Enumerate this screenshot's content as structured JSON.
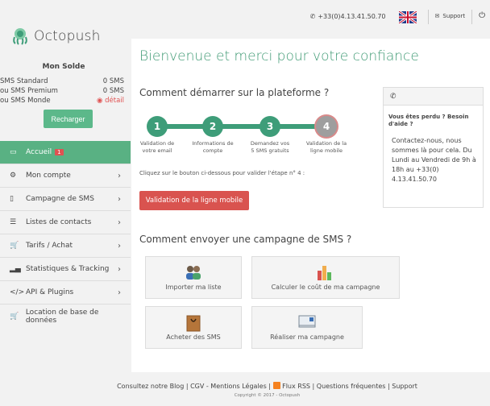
{
  "topbar": {
    "phone": "+33(0)4.13.41.50.70",
    "support_label": "Support"
  },
  "brand": {
    "name": "Octopush"
  },
  "balance": {
    "title": "Mon Solde",
    "rows": [
      {
        "label": "SMS Standard",
        "value": "0 SMS"
      },
      {
        "label": "ou SMS Premium",
        "value": "0 SMS"
      },
      {
        "label": "ou SMS Monde",
        "value": "détail"
      }
    ],
    "recharge_label": "Recharger"
  },
  "nav": {
    "items": [
      {
        "label": "Accueil",
        "badge": "1",
        "icon": "monitor-icon",
        "active": true
      },
      {
        "label": "Mon compte",
        "icon": "gear-icon"
      },
      {
        "label": "Campagne de SMS",
        "icon": "mobile-icon"
      },
      {
        "label": "Listes de contacts",
        "icon": "list-icon"
      },
      {
        "label": "Tarifs / Achat",
        "icon": "cart-icon"
      },
      {
        "label": "Statistiques & Tracking",
        "icon": "bar-chart-icon"
      },
      {
        "label": "API & Plugins",
        "icon": "code-icon"
      },
      {
        "label": "Location de base de données",
        "icon": "cart-icon"
      }
    ]
  },
  "main": {
    "welcome": "Bienvenue et merci pour votre confiance",
    "start_heading": "Comment démarrer sur la plateforme ?",
    "steps": [
      {
        "num": "1",
        "label": "Validation de votre email",
        "done": true
      },
      {
        "num": "2",
        "label": "Informations de compte",
        "done": true
      },
      {
        "num": "3",
        "label": "Demandez vos 5 SMS gratuits",
        "done": true
      },
      {
        "num": "4",
        "label": "Validation de la ligne mobile",
        "done": false
      }
    ],
    "instruction": "Cliquez sur le bouton ci-dessous pour valider l'étape n° 4 :",
    "validate_button": "Validation de la ligne mobile",
    "send_heading": "Comment envoyer une campagne de SMS ?",
    "tiles": [
      {
        "label": "Importer ma liste",
        "icon": "contacts-icon"
      },
      {
        "label": "Calculer le coût de ma campagne",
        "icon": "chart-icon"
      },
      {
        "label": "Acheter des SMS",
        "icon": "bag-icon"
      },
      {
        "label": "Réaliser ma campagne",
        "icon": "envelope-icon"
      }
    ]
  },
  "help": {
    "question": "Vous êtes perdu ? Besoin d'aide ?",
    "text": "Contactez-nous, nous sommes là pour cela. Du Lundi au Vendredi de 9h à 18h au +33(0) 4.13.41.50.70"
  },
  "footer": {
    "link_blog": "Consultez notre Blog",
    "link_cgv": "CGV - Mentions Légales",
    "link_rss": "Flux RSS",
    "link_faq": "Questions fréquentes",
    "link_support": "Support",
    "copyright": "Copyright © 2017 - Octopush"
  },
  "colors": {
    "accent": "#3e9d79",
    "nav_active": "#59b183",
    "danger": "#d9534f"
  }
}
